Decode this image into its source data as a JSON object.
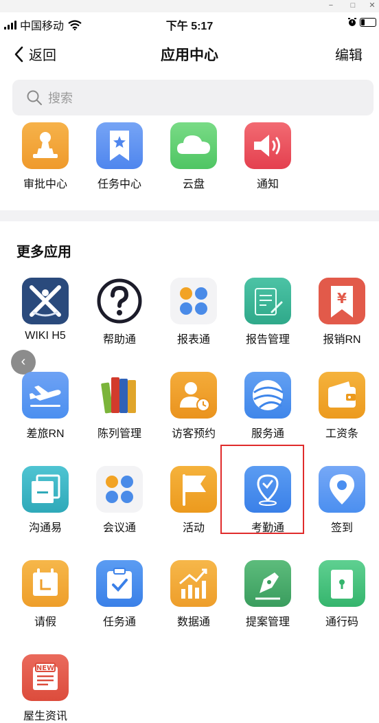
{
  "window_controls": [
    "−",
    "□",
    "✕"
  ],
  "status_bar": {
    "carrier": "中国移动",
    "time": "下午 5:17"
  },
  "nav": {
    "back_label": "返回",
    "title": "应用中心",
    "edit_label": "编辑"
  },
  "search": {
    "placeholder": "搜索"
  },
  "top_apps": [
    {
      "label": "审批中心",
      "icon": "stamp-icon",
      "color": "#f2a23a"
    },
    {
      "label": "任务中心",
      "icon": "bookmark-star-icon",
      "color": "#5b8ff0"
    },
    {
      "label": "云盘",
      "icon": "cloud-icon",
      "color": "#5fcf6e"
    },
    {
      "label": "通知",
      "icon": "speaker-icon",
      "color": "#ea5260"
    }
  ],
  "more_section": {
    "title": "更多应用",
    "apps": [
      {
        "label": "WIKI H5",
        "icon": "wiki-logo-icon",
        "color": "#2a4a7c"
      },
      {
        "label": "帮助通",
        "icon": "question-icon",
        "color": "#ffffff"
      },
      {
        "label": "报表通",
        "icon": "four-petal-icon",
        "color": "#f4f4f4"
      },
      {
        "label": "报告管理",
        "icon": "report-doc-icon",
        "color": "#3fb79a"
      },
      {
        "label": "报销RN",
        "icon": "yen-ribbon-icon",
        "color": "#e25a4a"
      },
      {
        "label": "差旅RN",
        "icon": "airplane-icon",
        "color": "#4b8ff0"
      },
      {
        "label": "陈列管理",
        "icon": "books-icon",
        "color": "#ffffff"
      },
      {
        "label": "访客预约",
        "icon": "visitor-clock-icon",
        "color": "#ef9a25"
      },
      {
        "label": "服务通",
        "icon": "globe-icon",
        "color": "#4a8be8"
      },
      {
        "label": "工资条",
        "icon": "wallet-icon",
        "color": "#f2a324"
      },
      {
        "label": "沟通易",
        "icon": "window-stack-icon",
        "color": "#38b6c6"
      },
      {
        "label": "会议通",
        "icon": "four-petal-icon",
        "color": "#f4f4f4"
      },
      {
        "label": "活动",
        "icon": "flag-icon",
        "color": "#f2a324"
      },
      {
        "label": "考勤通",
        "icon": "location-check-icon",
        "color": "#3f86ea"
      },
      {
        "label": "签到",
        "icon": "location-pin-icon",
        "color": "#4b8ff0"
      },
      {
        "label": "请假",
        "icon": "calendar-icon",
        "color": "#f2a324"
      },
      {
        "label": "任务通",
        "icon": "clipboard-check-icon",
        "color": "#4a8be8"
      },
      {
        "label": "数据通",
        "icon": "chart-up-icon",
        "color": "#f2a324"
      },
      {
        "label": "提案管理",
        "icon": "pen-nib-icon",
        "color": "#47a868"
      },
      {
        "label": "通行码",
        "icon": "door-icon",
        "color": "#3fbf7a"
      },
      {
        "label": "屋生资讯",
        "icon": "newspaper-icon",
        "color": "#e25a4a"
      }
    ]
  },
  "colors": {
    "highlight_box": "#e02b2b",
    "section_gap": "#f2f2f4",
    "search_bg": "#f0f0f2"
  },
  "float_button": "‹"
}
